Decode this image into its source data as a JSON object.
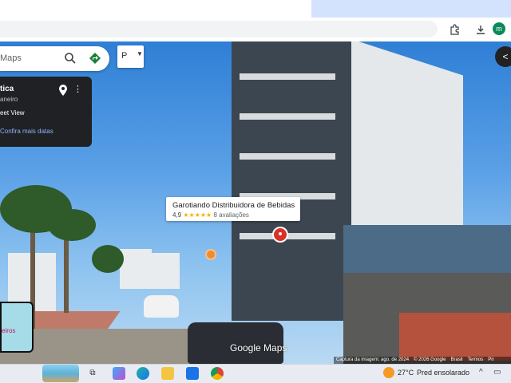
{
  "maps": {
    "search_text": "Maps",
    "pegman_label": "P",
    "info_card": {
      "title": "tica",
      "subtitle": "aneiro",
      "street_view_label": "eet View",
      "more_dates_link": "Confira mais datas"
    },
    "place": {
      "name": "Garotiando Distribuidora de Bebidas",
      "rating": "4,9",
      "stars": "★★★★★",
      "reviews": "8 avaliações"
    },
    "minimap_label": "eiros",
    "logo": "Google Maps",
    "attribution": {
      "capture": "Captura da imagem: ago. de 2024",
      "copyright": "© 2026 Google",
      "country": "Brasil",
      "terms": "Termos",
      "privacy": "Pri"
    }
  },
  "browser": {
    "profile_initial": "m"
  },
  "taskbar": {
    "weather_temp": "27°C",
    "weather_desc": "Pred ensolarado"
  },
  "colors": {
    "rating_star": "#f4b400",
    "place_pin": "#d93025",
    "link": "#8ab4f8"
  }
}
